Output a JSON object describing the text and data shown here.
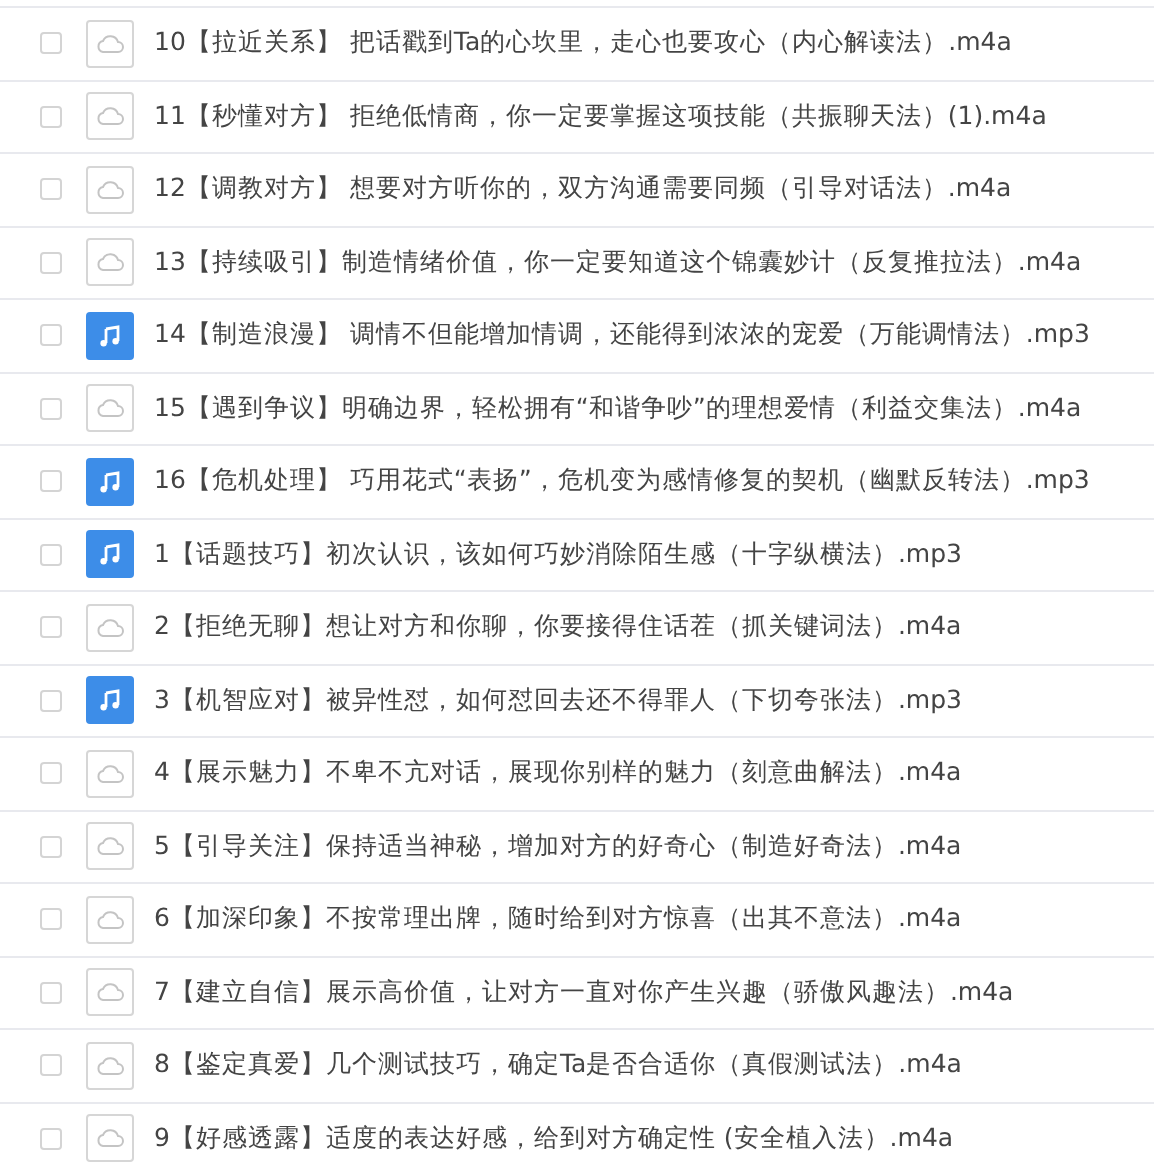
{
  "files": [
    {
      "name": "10【拉近关系】 把话戳到Ta的心坎里，走心也要攻心（内心解读法）.m4a",
      "kind": "cloud",
      "checked": false
    },
    {
      "name": "11【秒懂对方】 拒绝低情商，你一定要掌握这项技能（共振聊天法）(1).m4a",
      "kind": "cloud",
      "checked": false
    },
    {
      "name": "12【调教对方】 想要对方听你的，双方沟通需要同频（引导对话法）.m4a",
      "kind": "cloud",
      "checked": false
    },
    {
      "name": "13【持续吸引】制造情绪价值，你一定要知道这个锦囊妙计（反复推拉法）.m4a",
      "kind": "cloud",
      "checked": false
    },
    {
      "name": "14【制造浪漫】 调情不但能增加情调，还能得到浓浓的宠爱（万能调情法）.mp3",
      "kind": "audio",
      "checked": false
    },
    {
      "name": "15【遇到争议】明确边界，轻松拥有“和谐争吵”的理想爱情（利益交集法）.m4a",
      "kind": "cloud",
      "checked": false
    },
    {
      "name": "16【危机处理】 巧用花式“表扬”，危机变为感情修复的契机（幽默反转法）.mp3",
      "kind": "audio",
      "checked": false
    },
    {
      "name": "1【话题技巧】初次认识，该如何巧妙消除陌生感（十字纵横法）.mp3",
      "kind": "audio",
      "checked": false
    },
    {
      "name": "2【拒绝无聊】想让对方和你聊，你要接得住话茬（抓关键词法）.m4a",
      "kind": "cloud",
      "checked": false
    },
    {
      "name": "3【机智应对】被异性怼，如何怼回去还不得罪人（下切夸张法）.mp3",
      "kind": "audio",
      "checked": false
    },
    {
      "name": "4【展示魅力】不卑不亢对话，展现你别样的魅力（刻意曲解法）.m4a",
      "kind": "cloud",
      "checked": false
    },
    {
      "name": "5【引导关注】保持适当神秘，增加对方的好奇心（制造好奇法）.m4a",
      "kind": "cloud",
      "checked": false
    },
    {
      "name": "6【加深印象】不按常理出牌，随时给到对方惊喜（出其不意法）.m4a",
      "kind": "cloud",
      "checked": false
    },
    {
      "name": "7【建立自信】展示高价值，让对方一直对你产生兴趣（骄傲风趣法）.m4a",
      "kind": "cloud",
      "checked": false
    },
    {
      "name": "8【鉴定真爱】几个测试技巧，确定Ta是否合适你（真假测试法）.m4a",
      "kind": "cloud",
      "checked": false
    },
    {
      "name": "9【好感透露】适度的表达好感，给到对方确定性 (安全植入法）.m4a",
      "kind": "cloud",
      "checked": false
    }
  ]
}
